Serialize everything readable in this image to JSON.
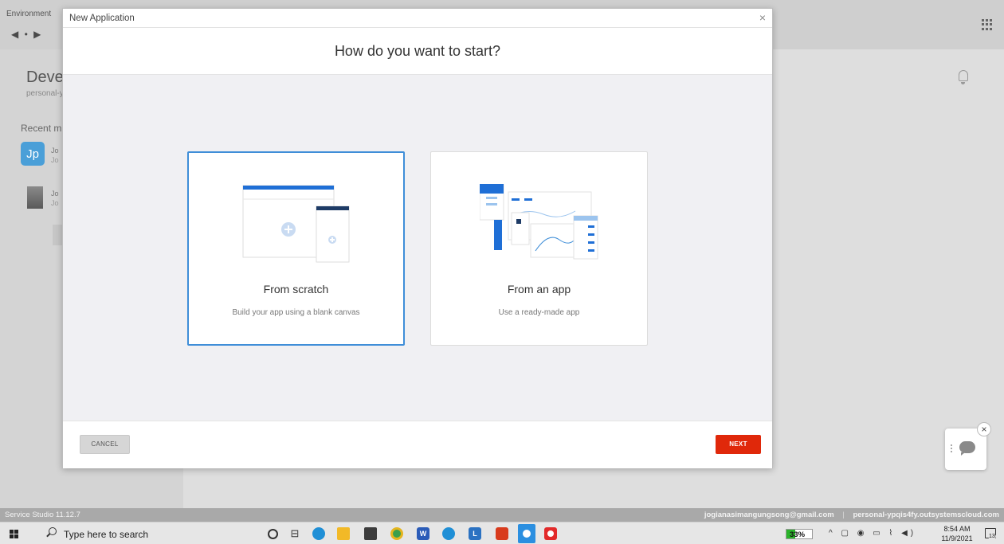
{
  "background": {
    "environment_label": "Environment",
    "nav_arrows": "◀ • ▶",
    "developer_title": "Develo",
    "developer_sub": "personal-y",
    "recent_label": "Recent m",
    "recent_items": [
      {
        "initials": "Jp",
        "line1": "Jo",
        "line2": "Jo"
      },
      {
        "line1": "Jo",
        "line2": "Jo"
      }
    ]
  },
  "status_bar": {
    "version": "Service Studio 11.12.7",
    "email": "jogianasimangungsong@gmail.com",
    "separator": "|",
    "environment": "personal-ypqis4fy.outsystemscloud.com"
  },
  "modal": {
    "window_title": "New Application",
    "close_glyph": "×",
    "heading": "How do you want to start?",
    "options": [
      {
        "title": "From scratch",
        "description": "Build your app using a blank canvas",
        "selected": true
      },
      {
        "title": "From an app",
        "description": "Use a ready-made app",
        "selected": false
      }
    ],
    "cancel_label": "CANCEL",
    "next_label": "NEXT"
  },
  "chat_widget": {
    "close_glyph": "×"
  },
  "taskbar": {
    "search_placeholder": "Type here to search",
    "task_view_glyph": "⊟",
    "word_letter": "W",
    "l_letter": "L",
    "battery_percent": 33,
    "battery_text": "33%",
    "tray_glyphs": "^ ▢ ◉ ▭ ⌇ ◀)",
    "time": "8:54 AM",
    "date": "11/9/2021",
    "notification_count": "13"
  },
  "colors": {
    "accent_blue": "#3f8ed8",
    "next_red": "#e0280a",
    "battery_green": "#2ab42a"
  }
}
